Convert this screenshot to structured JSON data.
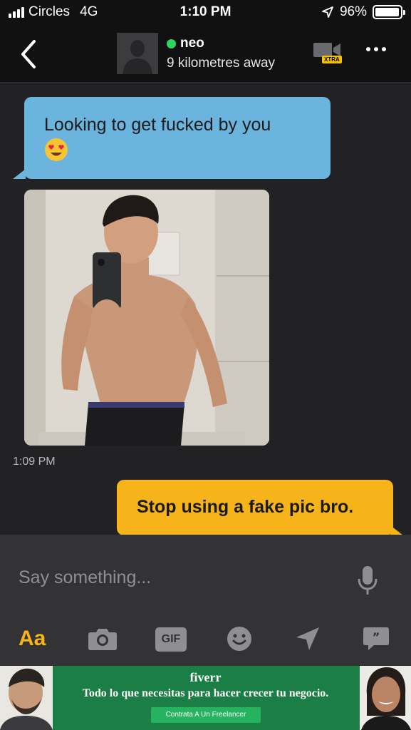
{
  "status_bar": {
    "carrier": "Circles",
    "network": "4G",
    "time": "1:10 PM",
    "battery_percent": "96%",
    "battery_level": 0.96
  },
  "header": {
    "contact_name": "neo",
    "distance": "9 kilometres away",
    "video_badge": "XTRA",
    "online_color": "#2fd45f"
  },
  "messages": {
    "incoming_text": "Looking to get fucked by you",
    "incoming_time": "1:09 PM",
    "outgoing_text": "Stop using a fake pic bro."
  },
  "composer": {
    "placeholder": "Say something...",
    "format_label": "Aa",
    "gif_label": "GIF",
    "icons": [
      "camera-icon",
      "gif-icon",
      "emoji-icon",
      "location-icon",
      "saved-phrases-icon"
    ]
  },
  "ad": {
    "brand": "fiverr",
    "tagline": "Todo lo que necesitas para hacer crecer tu negocio.",
    "cta": "Contrata A Un Freelancer"
  },
  "colors": {
    "accent": "#f6b41a",
    "incoming_bubble": "#6ab4de",
    "ad_background": "#1b7e44"
  }
}
